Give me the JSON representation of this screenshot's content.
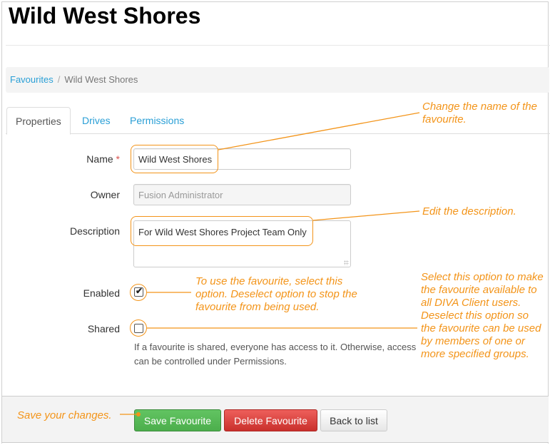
{
  "page": {
    "title": "Wild West Shores"
  },
  "breadcrumb": {
    "items": [
      {
        "label": "Favourites",
        "link": true
      },
      {
        "label": "Wild West Shores",
        "link": false
      }
    ],
    "separator": "/"
  },
  "tabs": [
    {
      "label": "Properties",
      "active": true
    },
    {
      "label": "Drives",
      "active": false
    },
    {
      "label": "Permissions",
      "active": false
    }
  ],
  "form": {
    "name": {
      "label": "Name",
      "required_marker": "*",
      "value": "Wild West Shores"
    },
    "owner": {
      "label": "Owner",
      "value": "Fusion Administrator",
      "readonly": true
    },
    "description": {
      "label": "Description",
      "value": "For Wild West Shores Project Team Only"
    },
    "enabled": {
      "label": "Enabled",
      "checked": true,
      "check_glyph": "✔"
    },
    "shared": {
      "label": "Shared",
      "checked": false
    },
    "shared_help": "If a favourite is shared, everyone has access to it. Otherwise, access can be controlled under Permissions."
  },
  "actions": {
    "save_label": "Save Favourite",
    "delete_label": "Delete Favourite",
    "back_label": "Back to list"
  },
  "annotations": {
    "name_note": "Change the name of the favourite.",
    "description_note": "Edit the description.",
    "enabled_note": "To use the favourite, select this option. Deselect option to stop the favourite from being used.",
    "shared_note": "Select this option to make the favourite available to all DIVA Client users. Deselect  this option so the favourite can be used by members of one or more specified groups.",
    "save_note": "Save your changes."
  },
  "colors": {
    "annotation": "#f39419",
    "link": "#2a9fd6",
    "save": "#5cb85c",
    "delete": "#d9534f"
  }
}
